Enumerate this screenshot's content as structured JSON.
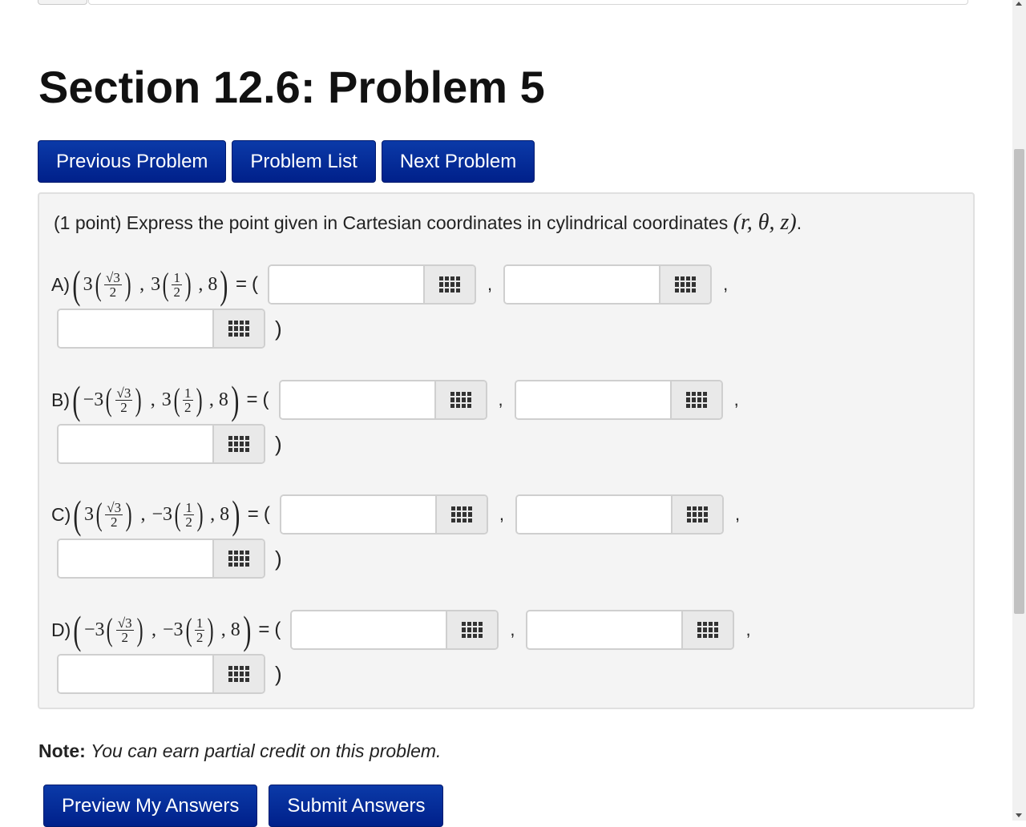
{
  "page_title": "Section 12.6: Problem 5",
  "nav": {
    "previous": "Previous Problem",
    "list": "Problem List",
    "next": "Next Problem"
  },
  "problem": {
    "points": "(1 point)",
    "text": "Express the point given in Cartesian coordinates in cylindrical coordinates",
    "coords": "(r, θ, z)",
    "period": "."
  },
  "parts": [
    {
      "label": "A)",
      "sign1": "",
      "c1": "3",
      "sign2": "",
      "c2": "3",
      "z": "8"
    },
    {
      "label": "B)",
      "sign1": "−",
      "c1": "3",
      "sign2": "",
      "c2": "3",
      "z": "8"
    },
    {
      "label": "C)",
      "sign1": "",
      "c1": "3",
      "sign2": "−",
      "c2": "3",
      "z": "8"
    },
    {
      "label": "D)",
      "sign1": "−",
      "c1": "3",
      "sign2": "−",
      "c2": "3",
      "z": "8"
    }
  ],
  "frac_sqrt3_over_2": {
    "num": "√3",
    "den": "2"
  },
  "frac_1_over_2": {
    "num": "1",
    "den": "2"
  },
  "symbols": {
    "equals": "=",
    "open": "(",
    "close": ")",
    "comma": ","
  },
  "inputs": {
    "A_r": "",
    "A_theta": "",
    "A_z": "",
    "B_r": "",
    "B_theta": "",
    "B_z": "",
    "C_r": "",
    "C_theta": "",
    "C_z": "",
    "D_r": "",
    "D_theta": "",
    "D_z": ""
  },
  "note": {
    "label": "Note:",
    "text": "You can earn partial credit on this problem."
  },
  "actions": {
    "preview": "Preview My Answers",
    "submit": "Submit Answers"
  },
  "icons": {
    "keyboard": "grid-keyboard-icon"
  }
}
